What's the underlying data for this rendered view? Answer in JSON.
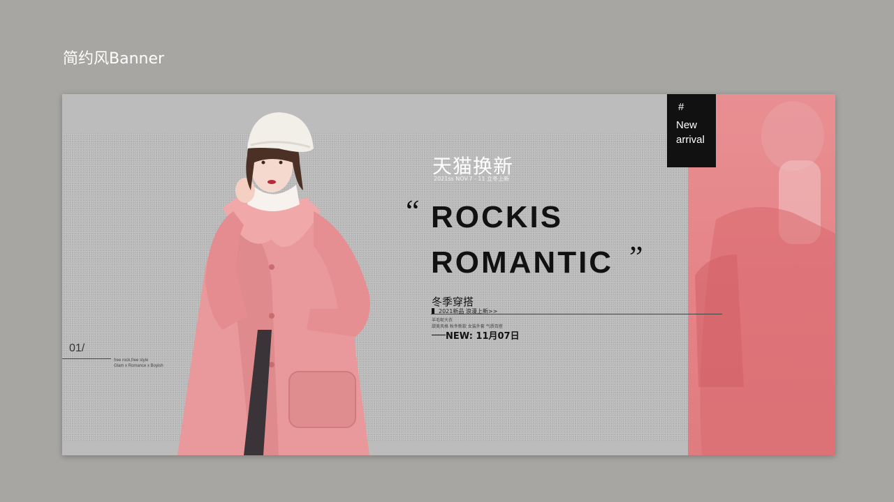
{
  "page": {
    "title": "简约风Banner"
  },
  "banner": {
    "tag": {
      "hash": "#",
      "line1": "New",
      "line2": "arrival"
    },
    "slide": {
      "number": "01/",
      "caption1": "free rock,free style",
      "caption2": "Glam x Romance x Boyish"
    },
    "cn_title": "天猫换新",
    "cn_sub": "2021ss NOV.7 - 11 立冬上新",
    "quote_open": "“",
    "headline1": "ROCKIS",
    "headline2": "ROMANTIC",
    "quote_close": "”",
    "season": "冬季穿搭",
    "sub_new": "2021新品 浪漫上新>>",
    "tiny1": "羊毛呢大衣",
    "tiny2": "甜美风格 秋冬新款 女装外套 气质百搭",
    "date": "NEW: 11月07日"
  },
  "colors": {
    "background": "#a7a6a3",
    "banner_gray": "#b9b9b9",
    "accent_pink": "#e58388",
    "tag_black": "#111111"
  }
}
